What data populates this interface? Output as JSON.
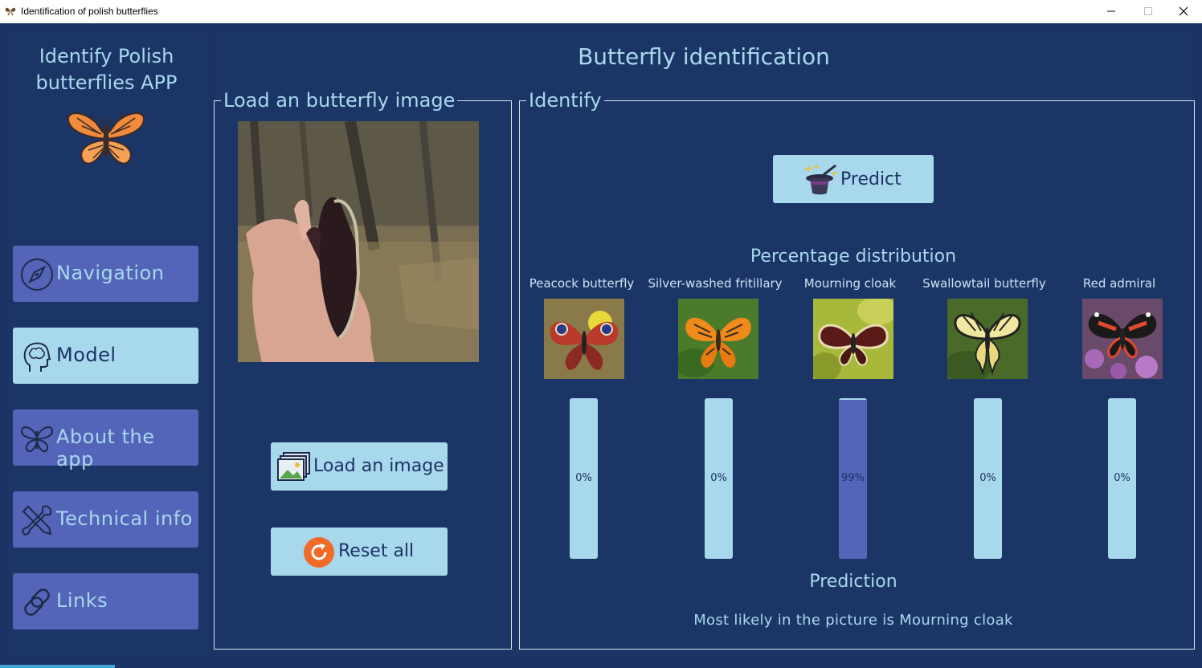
{
  "window": {
    "title": "Identification of polish butterflies",
    "icon": "butterfly-icon"
  },
  "sidebar": {
    "app_name_line1": "Identify Polish",
    "app_name_line2": "butterflies APP",
    "logo": "butterfly-logo",
    "items": [
      {
        "label": "Navigation",
        "icon": "compass-icon",
        "active": false
      },
      {
        "label": "Model",
        "icon": "brain-head-icon",
        "active": true
      },
      {
        "label": "About the app",
        "icon": "butterfly-icon",
        "active": false
      },
      {
        "label": "Technical info",
        "icon": "tools-icon",
        "active": false
      },
      {
        "label": "Links",
        "icon": "link-icon",
        "active": false
      }
    ]
  },
  "main": {
    "title": "Butterfly identification",
    "load_panel": {
      "title": "Load an butterfly image",
      "load_button": "Load an image",
      "reset_button": "Reset all"
    },
    "identify_panel": {
      "title": "Identify",
      "predict_button": "Predict",
      "distribution_title": "Percentage distribution",
      "classes": [
        {
          "name": "Peacock butterfly",
          "percent_label": "0%",
          "value": 0
        },
        {
          "name": "Silver-washed fritillary",
          "percent_label": "0%",
          "value": 0
        },
        {
          "name": "Mourning cloak",
          "percent_label": "99%",
          "value": 99
        },
        {
          "name": "Swallowtail butterfly",
          "percent_label": "0%",
          "value": 0
        },
        {
          "name": "Red admiral",
          "percent_label": "0%",
          "value": 0
        }
      ],
      "prediction_title": "Prediction",
      "prediction_text": "Most likely in the picture is Mourning cloak"
    }
  },
  "colors": {
    "background": "#1d3266",
    "accent_light": "#a8d8ec",
    "accent_button": "#5464b8"
  }
}
